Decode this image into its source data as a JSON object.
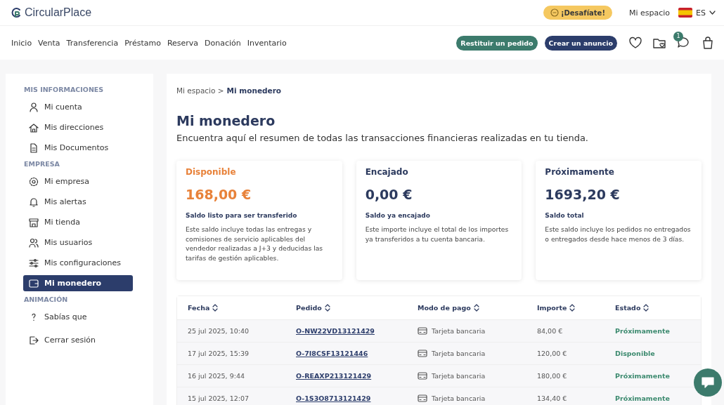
{
  "brand": {
    "name": "CircularPlace"
  },
  "top_bar": {
    "challenge_button": "¡Desafíate!",
    "account_link": "Mi espacio",
    "language": "ES"
  },
  "nav": {
    "items": [
      "Inicio",
      "Venta",
      "Transferencia",
      "Préstamo",
      "Reserva",
      "Donación",
      "Inventario"
    ],
    "return_button": "Restituir un pedido",
    "create_button": "Crear un anuncio",
    "messages_badge": "1"
  },
  "sidebar": {
    "sections": [
      {
        "title": "MIS INFORMACIONES",
        "items": [
          {
            "label": "Mi cuenta",
            "selected": false
          },
          {
            "label": "Mis direcciones",
            "selected": false
          },
          {
            "label": "Mis Documentos",
            "selected": false
          }
        ]
      },
      {
        "title": "EMPRESA",
        "items": [
          {
            "label": "Mi empresa",
            "selected": false
          },
          {
            "label": "Mis alertas",
            "selected": false
          },
          {
            "label": "Mi tienda",
            "selected": false
          },
          {
            "label": "Mis usuarios",
            "selected": false
          },
          {
            "label": "Mis configuraciones",
            "selected": false
          },
          {
            "label": "Mi monedero",
            "selected": true
          }
        ]
      },
      {
        "title": "ANIMACIÓN",
        "items": [
          {
            "label": "Sabías que",
            "selected": false
          }
        ]
      }
    ],
    "logout": "Cerrar sesión"
  },
  "breadcrumb": {
    "parent": "Mi espacio >",
    "current": "Mi monedero"
  },
  "page": {
    "title": "Mi monedero",
    "subtitle": "Encuentra aquí el resumen de todas las transacciones financieras realizadas en tu tienda."
  },
  "balances": [
    {
      "kind": "available",
      "title": "Disponible",
      "amount": "168,00 €",
      "label": "Saldo listo para ser transferido",
      "description": "Este saldo incluye todas las entregas y comisiones de servicio aplicables del vendedor realizadas a J+3 y deducidas las tarifas de gestión aplicables."
    },
    {
      "kind": "default",
      "title": "Encajado",
      "amount": "0,00 €",
      "label": "Saldo ya encajado",
      "description": "Este importe incluye el total de los importes ya transferidos a tu cuenta bancaria."
    },
    {
      "kind": "default",
      "title": "Próximamente",
      "amount": "1693,20 €",
      "label": "Saldo total",
      "description": "Este saldo incluye los pedidos no entregados o entregados desde hace menos de 3 días."
    }
  ],
  "table": {
    "columns": [
      "Fecha",
      "Pedido",
      "Modo de pago",
      "Importe",
      "Estado"
    ],
    "rows": [
      {
        "date": "25 jul 2025, 10:40",
        "order": "O-NW22VD13121429",
        "payment": "Tarjeta bancaria",
        "amount": "84,00 €",
        "status": "Próximamente"
      },
      {
        "date": "17 jul 2025, 15:39",
        "order": "O-7I8CSF13121446",
        "payment": "Tarjeta bancaria",
        "amount": "120,00 €",
        "status": "Disponible"
      },
      {
        "date": "16 jul 2025, 9:44",
        "order": "O-REAXP213121429",
        "payment": "Tarjeta bancaria",
        "amount": "180,00 €",
        "status": "Próximamente"
      },
      {
        "date": "15 jul 2025, 12:07",
        "order": "O-1S3O8713121429",
        "payment": "Tarjeta bancaria",
        "amount": "134,40 €",
        "status": "Próximamente"
      }
    ]
  }
}
